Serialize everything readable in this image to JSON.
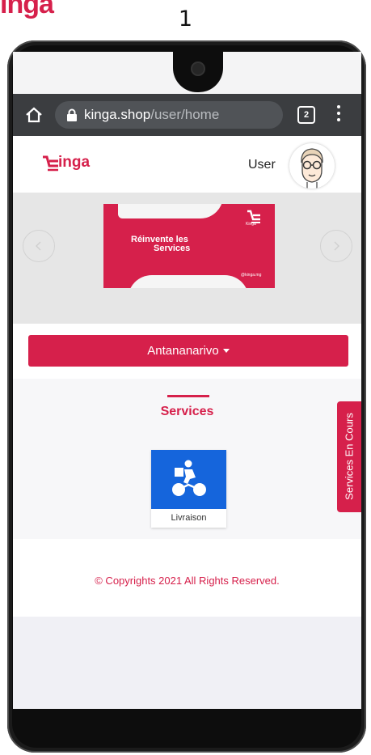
{
  "top_logo": "inga",
  "page_number": "1",
  "browser": {
    "url_host": "kinga.shop",
    "url_path": "/user/home",
    "tab_count": "2"
  },
  "header": {
    "logo_text": "inga",
    "user_label": "User"
  },
  "carousel": {
    "banner_line1": "Réinvente les",
    "banner_line2": "Services",
    "banner_logo_text": "Kinga",
    "banner_handle": "@kinga.mg"
  },
  "city_selector": {
    "label": "Antananarivo"
  },
  "services": {
    "title": "Services",
    "items": [
      {
        "label": "Livraison"
      }
    ]
  },
  "side_tab": {
    "label": "Services En Cours"
  },
  "footer": {
    "copyright": "© Copyrights 2021 All Rights Reserved."
  },
  "colors": {
    "brand": "#d6204b",
    "service_blue": "#1565dc",
    "browser_bar": "#3b3d40"
  }
}
